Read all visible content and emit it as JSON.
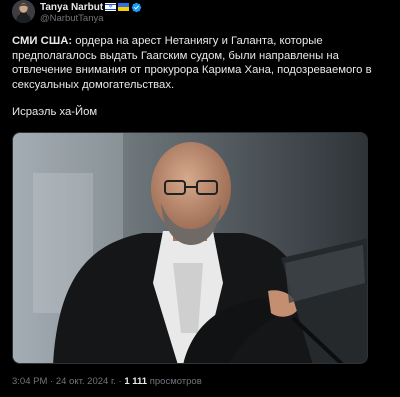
{
  "author": {
    "name": "Tanya Narbut",
    "handle": "@NarbutTanya",
    "verified": true,
    "flags": [
      "israel-flag-icon",
      "ukraine-flag-icon"
    ]
  },
  "tweet": {
    "lead": "СМИ США:",
    "line1_rest": " ордера на арест Нетаниягу и Галанта, которые",
    "line2": "предполагалось выдать Гаагским судом, были направлены на",
    "line3": "отвлечение внимания от прокурора Карима Хана, подозреваемого в",
    "line4": "сексуальных домогательствах.",
    "signature": "Исраэль ха-Йом"
  },
  "media": {
    "icon": "photo-of-man-in-judicial-robe"
  },
  "meta": {
    "time": "3:04 PM",
    "separator1": " · ",
    "date": "24 окт. 2024 г.",
    "separator2": " · ",
    "views": "1 111",
    "views_label": " просмотров"
  },
  "colors": {
    "background": "#000000",
    "text": "#e7e9ea",
    "muted": "#71767b",
    "verified": "#1d9bf0"
  }
}
